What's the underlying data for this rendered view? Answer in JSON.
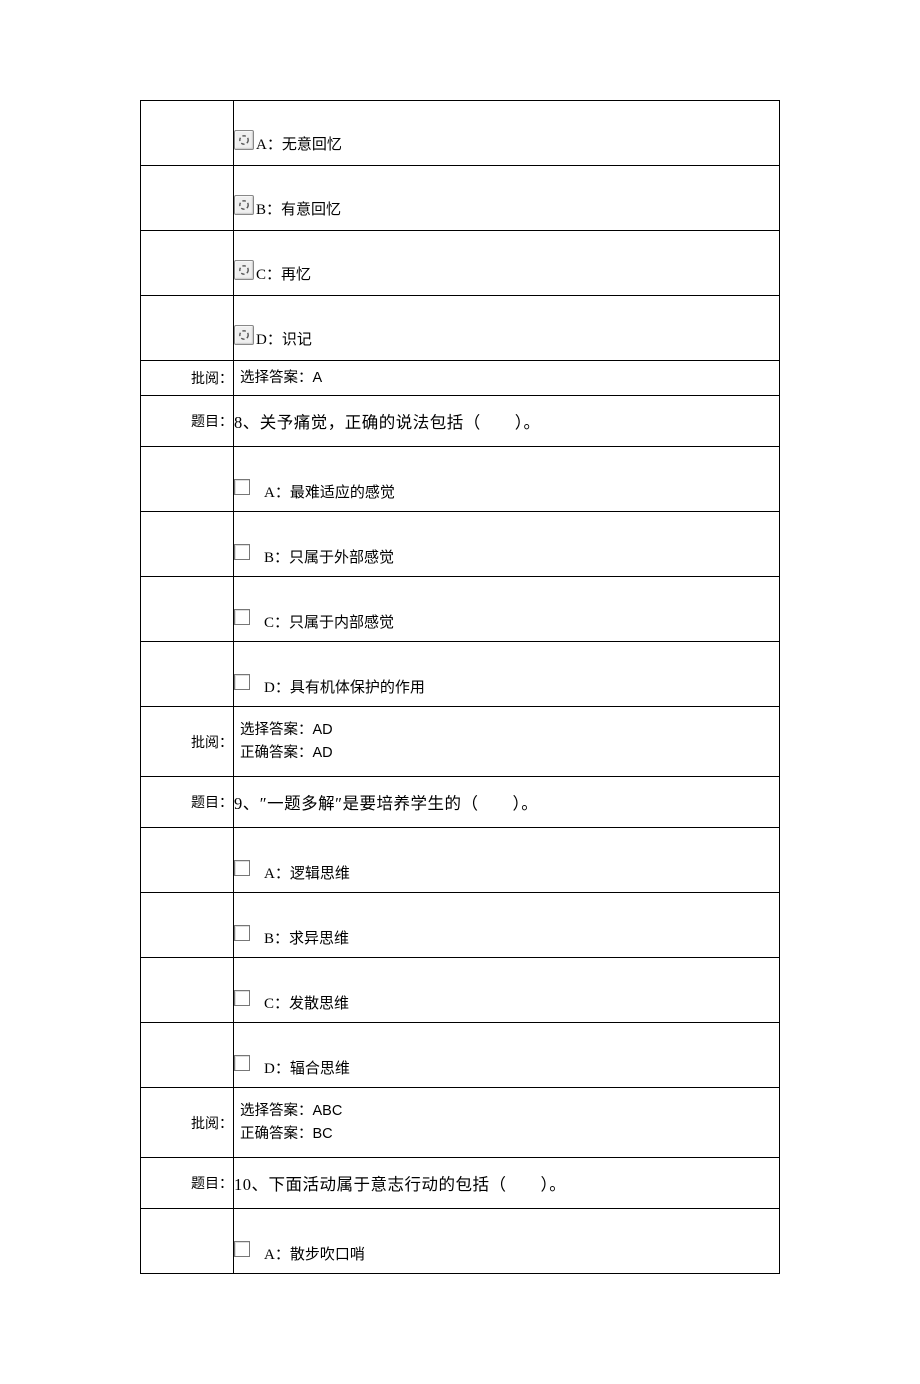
{
  "labels": {
    "piyue": "批阅：",
    "timu": "题目：",
    "selected_prefix": "选择答案：",
    "correct_prefix": "正确答案："
  },
  "rows": [
    {
      "type": "radio_option",
      "text": "A：无意回忆"
    },
    {
      "type": "radio_option",
      "text": "B：有意回忆"
    },
    {
      "type": "radio_option",
      "text": "C：再忆"
    },
    {
      "type": "radio_option",
      "text": "D：识记"
    },
    {
      "type": "answer_single",
      "selected": "A"
    },
    {
      "type": "question",
      "text": "8、关予痛觉，正确的说法包括（　　）。"
    },
    {
      "type": "check_option",
      "text": "A：最难适应的感觉"
    },
    {
      "type": "check_option",
      "text": "B：只属于外部感觉"
    },
    {
      "type": "check_option",
      "text": "C：只属于内部感觉"
    },
    {
      "type": "check_option",
      "text": "D：具有机体保护的作用"
    },
    {
      "type": "answer_double",
      "selected": "AD",
      "correct": "AD"
    },
    {
      "type": "question",
      "text": "9、″一题多解″是要培养学生的（　　）。"
    },
    {
      "type": "check_option",
      "text": "A：逻辑思维"
    },
    {
      "type": "check_option",
      "text": "B：求异思维"
    },
    {
      "type": "check_option",
      "text": "C：发散思维"
    },
    {
      "type": "check_option",
      "text": "D：辐合思维"
    },
    {
      "type": "answer_double",
      "selected": "ABC",
      "correct": "BC"
    },
    {
      "type": "question",
      "text": "10、下面活动属于意志行动的包括（　　）。"
    },
    {
      "type": "check_option",
      "text": "A：散步吹口哨"
    }
  ]
}
